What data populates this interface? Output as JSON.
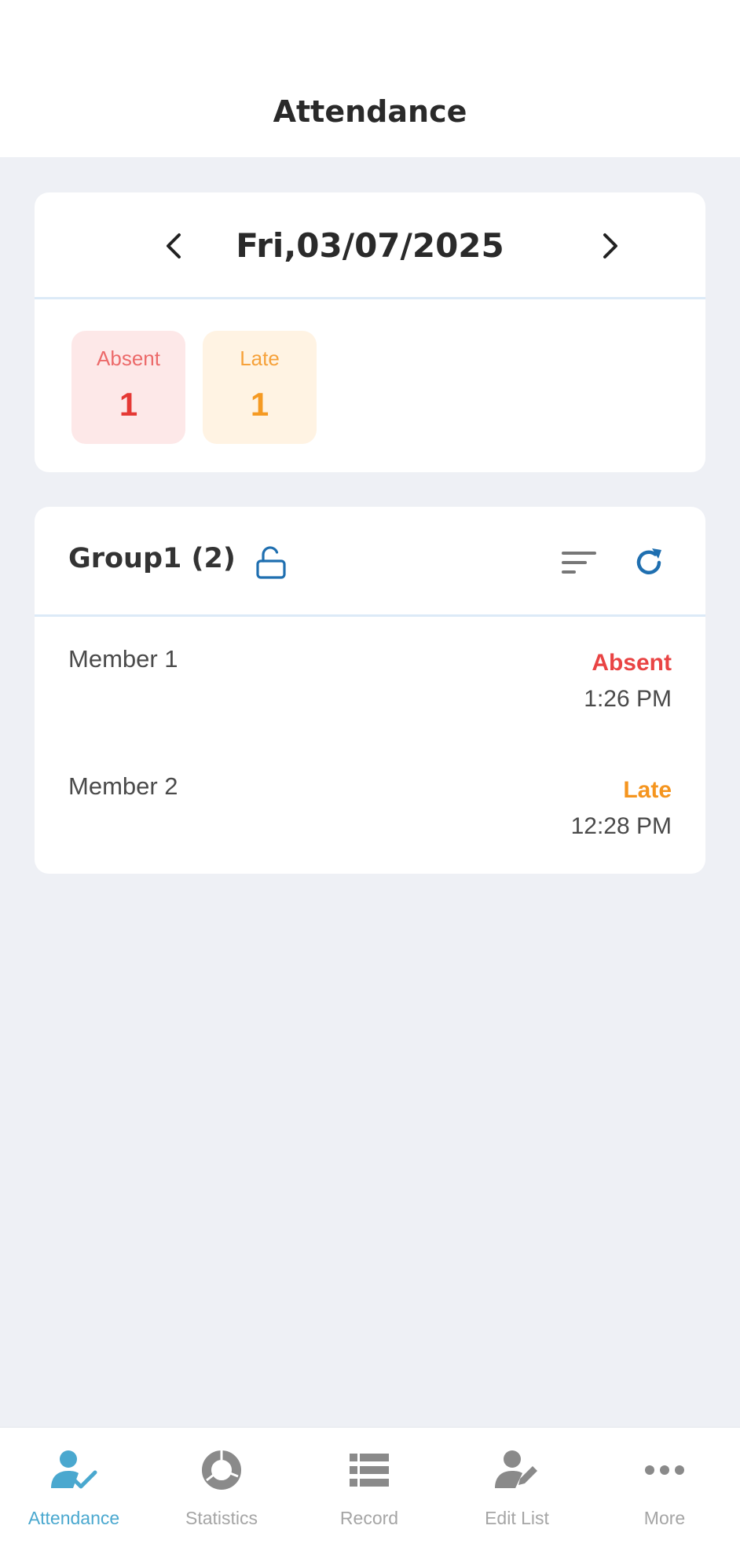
{
  "header": {
    "title": "Attendance"
  },
  "date_nav": {
    "date": "Fri,03/07/2025"
  },
  "summary": {
    "absent": {
      "label": "Absent",
      "count": "1"
    },
    "late": {
      "label": "Late",
      "count": "1"
    }
  },
  "group": {
    "title": "Group1 (2)",
    "members": [
      {
        "name": "Member 1",
        "status": "Absent",
        "time": "1:26 PM"
      },
      {
        "name": "Member 2",
        "status": "Late",
        "time": "12:28 PM"
      }
    ]
  },
  "tabs": [
    {
      "label": "Attendance",
      "icon": "user-check-icon",
      "active": true
    },
    {
      "label": "Statistics",
      "icon": "donut-chart-icon",
      "active": false
    },
    {
      "label": "Record",
      "icon": "list-icon",
      "active": false
    },
    {
      "label": "Edit List",
      "icon": "user-edit-icon",
      "active": false
    },
    {
      "label": "More",
      "icon": "more-dots-icon",
      "active": false
    }
  ],
  "colors": {
    "accent": "#4aa8cf",
    "absent": "#e94444",
    "late": "#f5951f",
    "icon_blue": "#1f6fb0",
    "background": "#eef0f5"
  }
}
